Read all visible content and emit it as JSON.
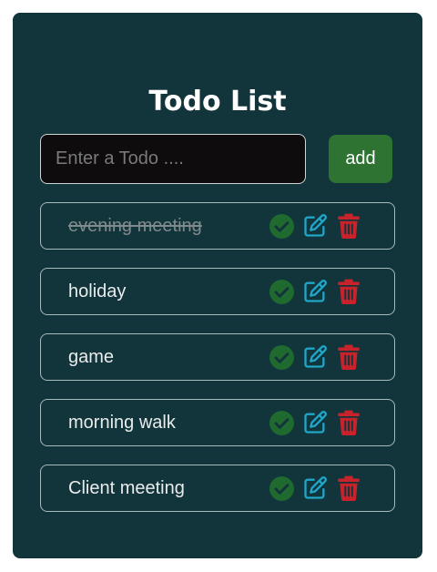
{
  "app": {
    "title": "Todo List"
  },
  "form": {
    "input_value": "",
    "input_placeholder": "Enter a Todo ....",
    "add_label": "add"
  },
  "todos": [
    {
      "text": "evening meeting",
      "done": true
    },
    {
      "text": "holiday",
      "done": false
    },
    {
      "text": "game",
      "done": false
    },
    {
      "text": "morning walk",
      "done": false
    },
    {
      "text": "Client meeting",
      "done": false
    }
  ],
  "icons": {
    "complete": "check-circle-icon",
    "edit": "edit-icon",
    "delete": "trash-icon"
  },
  "colors": {
    "card_background": "#12343b",
    "add_button": "#2e7332",
    "complete_icon": "#1f6a2f",
    "edit_icon": "#1fa6c8",
    "delete_icon": "#c9222a",
    "done_text": "#7f8a8c"
  }
}
